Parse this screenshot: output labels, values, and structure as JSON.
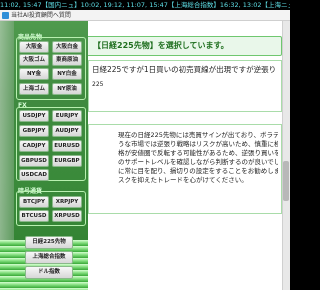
{
  "ticker": "11:02, 15:47【国内ニュ】10:02, 19:12, 11:07, 15:47【上海総合指数】16:32, 13:02【上海ニュ",
  "window": {
    "title": "当社AI投資顧問へ質問"
  },
  "left": {
    "section_products": "商品先物",
    "products": [
      "大阪金",
      "大阪白金",
      "大阪ゴム",
      "東商原油",
      "NY金",
      "NY白金",
      "上海ゴム",
      "NY原油"
    ],
    "section_fx": "FX",
    "fx": [
      "USDJPY",
      "EURJPY",
      "GBPJPY",
      "AUDJPY",
      "CADJPY",
      "EURUSD",
      "GBPUSD",
      "EURGBP",
      "USDCAD"
    ],
    "section_crypto": "暗号通貨",
    "crypto": [
      "BTCJPY",
      "XRPJPY",
      "BTCUSD",
      "XRPUSD"
    ],
    "indices": [
      "日経225先物",
      "上海総合指数",
      "ドル指数"
    ]
  },
  "main": {
    "header_prefix": "【",
    "header_name": "日経225先物",
    "header_suffix": "】を選択しています。",
    "question": "日経225ですが1日買いの初売買線が出現ですが逆張り",
    "question_end": "225",
    "answer_lines": [
      "現在の日経225先物には売買サインが出ており、ボラティリティ",
      "うな市場では逆張り戦略はリスクが高いため、慎重に検討する必",
      "格が安値圏で反転する可能性があるため、逆張り買いを行う場合は",
      "のサポートレベルを確認しながら判断するのが良いでしょう。また",
      "に常に目を配り、損切りの設定をすることをお勧めします。明確な",
      "スクを抑えたトレードを心がけてください。"
    ]
  }
}
